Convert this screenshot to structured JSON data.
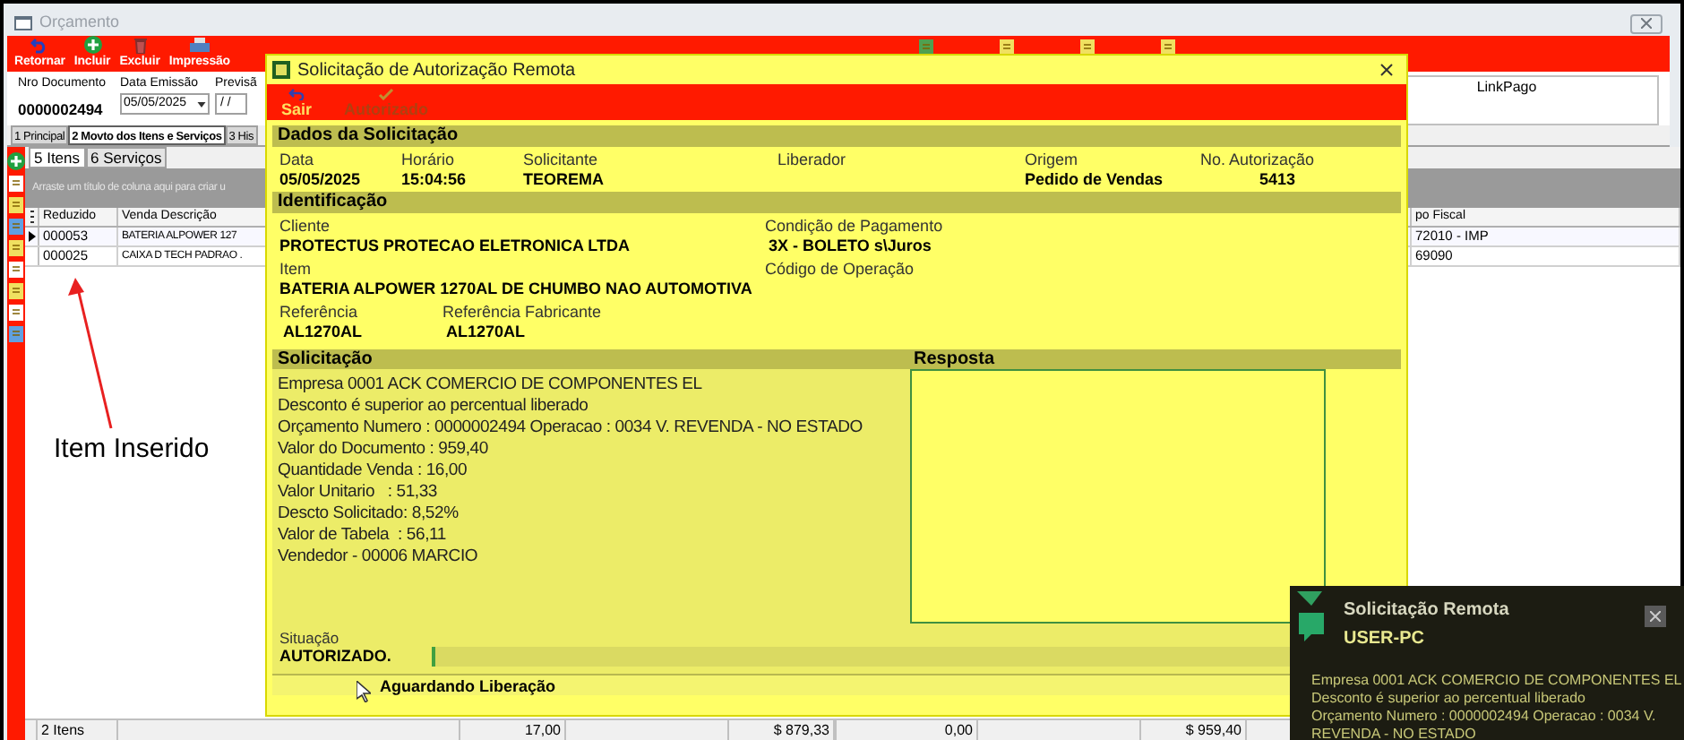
{
  "main_window": {
    "title": "Orçamento",
    "toolbar": [
      {
        "label": "Retornar",
        "kind": "undo"
      },
      {
        "label": "Incluir",
        "kind": "add"
      },
      {
        "label": "Excluir",
        "kind": "delete"
      },
      {
        "label": "Impressão",
        "kind": "print"
      }
    ],
    "form": {
      "document_label": "Nro Documento",
      "document_value": "0000002494",
      "date_label": "Data Emissão",
      "date_value": "05/05/2025",
      "forecast_label": "Previsã",
      "forecast_value": "/ /",
      "link_label": "LinkPago"
    },
    "tabs": [
      {
        "label": "1 Principal",
        "selected": false
      },
      {
        "label": "2 Movto dos Itens e Serviços",
        "selected": true
      },
      {
        "label": "3 His",
        "selected": false
      }
    ],
    "subtabs": [
      {
        "label": "5 Itens",
        "selected": true
      },
      {
        "label": "6 Serviços",
        "selected": false
      }
    ],
    "group_hint": "Arraste um título de coluna aqui para criar u",
    "grid": {
      "columns": [
        "Reduzido",
        "Venda Descrição",
        "po Fiscal"
      ],
      "rows": [
        {
          "cells": [
            "000053",
            "BATERIA ALPOWER 127",
            "72010 - IMP"
          ],
          "selected": true
        },
        {
          "cells": [
            "000025",
            "CAIXA D TECH PADRAO .",
            "69090"
          ],
          "selected": false
        }
      ]
    },
    "footer": {
      "count": "2 Itens",
      "totals": [
        "17,00",
        "$ 879,33",
        "0,00",
        "$ 959,40"
      ]
    }
  },
  "annotation": {
    "text": "Item Inserido"
  },
  "dialog": {
    "title": "Solicitação de Autorização Remota",
    "toolbar": [
      {
        "label": "Sair",
        "disabled": false
      },
      {
        "label": "Autorizado",
        "disabled": true
      }
    ],
    "request_data": {
      "header": "Dados da Solicitação",
      "fields": [
        {
          "label": "Data",
          "value": "05/05/2025"
        },
        {
          "label": "Horário",
          "value": "15:04:56"
        },
        {
          "label": "Solicitante",
          "value": "TEOREMA"
        },
        {
          "label": "Liberador"
        },
        {
          "label": "Origem",
          "value": "Pedido de Vendas"
        },
        {
          "label": "No. Autorização",
          "value": "5413"
        }
      ]
    },
    "identification": {
      "header": "Identificação",
      "client_label": "Cliente",
      "client": "PROTECTUS PROTECAO ELETRONICA LTDA",
      "payment_label": "Condição de Pagamento",
      "payment": "3X - BOLETO s\\Juros",
      "item_label": "Item",
      "item": "BATERIA ALPOWER 1270AL DE CHUMBO NAO AUTOMOTIVA",
      "operation_label": "Código de Operação",
      "reference_label": "Referência",
      "reference": "AL1270AL",
      "maker_reference_label": "Referência Fabricante",
      "maker_reference": "AL1270AL"
    },
    "request": {
      "header": "Solicitação",
      "lines": [
        "Empresa 0001 ACK COMERCIO DE COMPONENTES EL",
        "Desconto é superior ao percentual liberado",
        "Orçamento Numero : 0000002494 Operacao : 0034 V. REVENDA - NO ESTADO",
        "Valor do Documento : 959,40",
        "Quantidade Venda : 16,00",
        "Valor Unitario   : 51,33",
        "Descto Solicitado: 8,52%",
        "Valor de Tabela  : 56,11",
        "Vendedor - 00006 MARCIO"
      ]
    },
    "response": {
      "header": "Resposta"
    },
    "situation": {
      "label": "Situação",
      "value": "AUTORIZADO."
    },
    "status": "Aguardando Liberação"
  },
  "notification": {
    "title": "Solicitação Remota",
    "host": "USER-PC",
    "lines": [
      "Empresa 0001 ACK COMERCIO DE COMPONENTES EL",
      "Desconto é superior ao percentual liberado",
      "Orçamento Numero : 0000002494 Operacao : 0034 V.",
      "REVENDA - NO ESTADO"
    ]
  }
}
